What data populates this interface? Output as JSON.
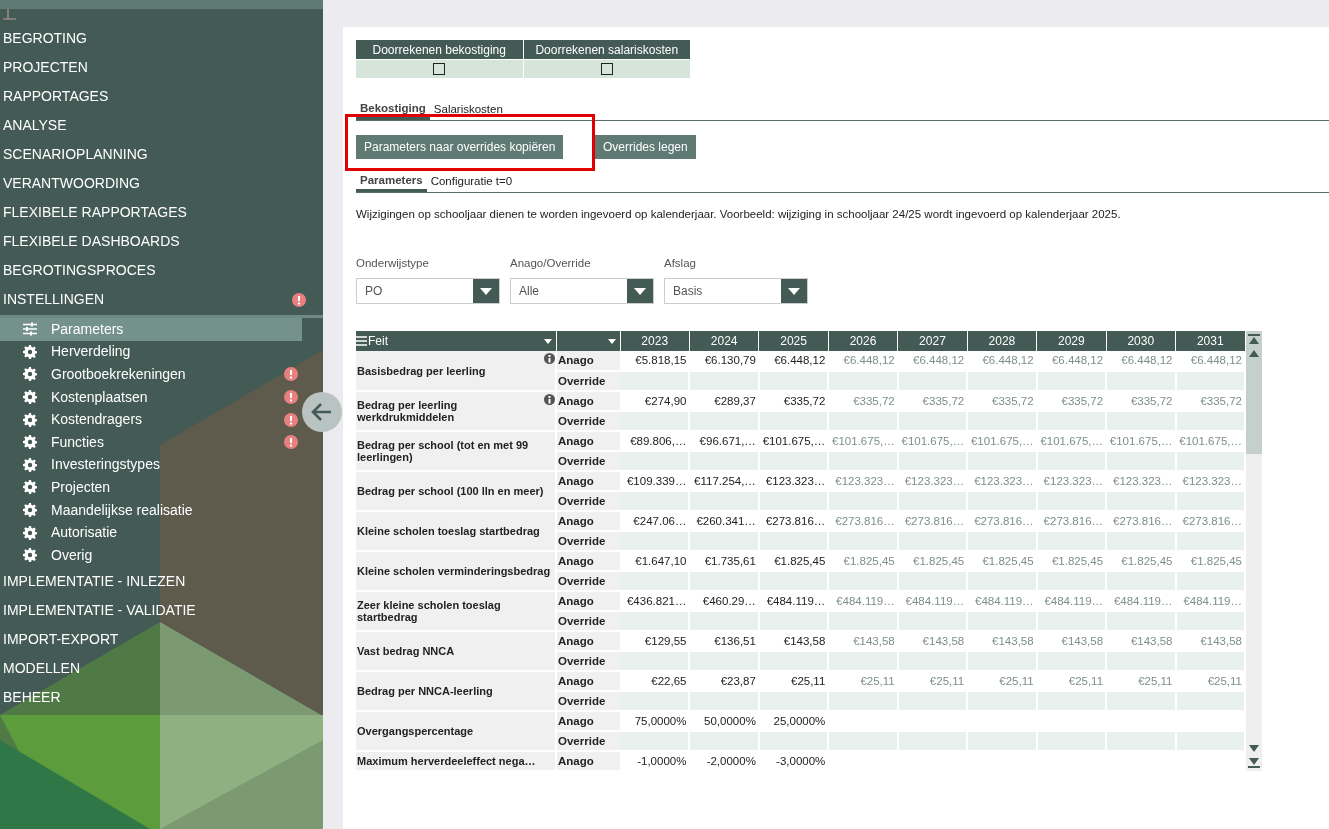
{
  "sidebar": {
    "items": [
      {
        "label": "BEGROTING",
        "alert": false
      },
      {
        "label": "PROJECTEN",
        "alert": false
      },
      {
        "label": "RAPPORTAGES",
        "alert": false
      },
      {
        "label": "ANALYSE",
        "alert": false
      },
      {
        "label": "SCENARIOPLANNING",
        "alert": false
      },
      {
        "label": "VERANTWOORDING",
        "alert": false
      },
      {
        "label": "FLEXIBELE RAPPORTAGES",
        "alert": false
      },
      {
        "label": "FLEXIBELE DASHBOARDS",
        "alert": false
      },
      {
        "label": "BEGROTINGSPROCES",
        "alert": false
      },
      {
        "label": "INSTELLINGEN",
        "alert": true,
        "children": [
          {
            "label": "Parameters",
            "kind": "sliders",
            "selected": true,
            "alert": false
          },
          {
            "label": "Herverdeling",
            "kind": "gear",
            "selected": false,
            "alert": false
          },
          {
            "label": "Grootboekrekeningen",
            "kind": "gear",
            "selected": false,
            "alert": true
          },
          {
            "label": "Kostenplaatsen",
            "kind": "gear",
            "selected": false,
            "alert": true
          },
          {
            "label": "Kostendragers",
            "kind": "gear",
            "selected": false,
            "alert": true
          },
          {
            "label": "Functies",
            "kind": "gear",
            "selected": false,
            "alert": true
          },
          {
            "label": "Investeringstypes",
            "kind": "gear",
            "selected": false,
            "alert": false
          },
          {
            "label": "Projecten",
            "kind": "gear",
            "selected": false,
            "alert": false
          },
          {
            "label": "Maandelijkse realisatie",
            "kind": "gear",
            "selected": false,
            "alert": false
          },
          {
            "label": "Autorisatie",
            "kind": "gear",
            "selected": false,
            "alert": false
          },
          {
            "label": "Overig",
            "kind": "gear",
            "selected": false,
            "alert": false
          }
        ]
      },
      {
        "label": "IMPLEMENTATIE - INLEZEN",
        "alert": false
      },
      {
        "label": "IMPLEMENTATIE - VALIDATIE",
        "alert": false
      },
      {
        "label": "IMPORT-EXPORT",
        "alert": false
      },
      {
        "label": "MODELLEN",
        "alert": false
      },
      {
        "label": "BEHEER",
        "alert": false
      }
    ]
  },
  "recalculate": [
    {
      "label": "Doorrekenen bekostiging",
      "checked": false
    },
    {
      "label": "Doorrekenen salariskosten",
      "checked": false
    }
  ],
  "tabs": [
    {
      "label": "Bekostiging",
      "selected": true
    },
    {
      "label": "Salariskosten",
      "selected": false
    }
  ],
  "buttons": [
    {
      "label": "Parameters naar overrides kopiëren",
      "highlighted": true
    },
    {
      "label": "Overrides legen"
    }
  ],
  "sub_tabs": [
    {
      "label": "Parameters",
      "selected": true
    },
    {
      "label": "Configuratie t=0",
      "selected": false
    }
  ],
  "note": "Wijzigingen op schooljaar dienen te worden ingevoerd op kalenderjaar. Voorbeeld: wijziging in schooljaar 24/25 wordt ingevoerd op kalenderjaar 2025.",
  "filters": [
    {
      "label": "Onderwijstype",
      "value": "PO"
    },
    {
      "label": "Anago/Override",
      "value": "Alle"
    },
    {
      "label": "Afslag",
      "value": "Basis"
    }
  ],
  "table": {
    "fact_column": "Feit",
    "years": [
      {
        "label": "2023",
        "projected": false
      },
      {
        "label": "2024",
        "projected": false
      },
      {
        "label": "2025",
        "projected": false
      },
      {
        "label": "2026",
        "projected": true
      },
      {
        "label": "2027",
        "projected": true
      },
      {
        "label": "2028",
        "projected": true
      },
      {
        "label": "2029",
        "projected": true
      },
      {
        "label": "2030",
        "projected": true
      },
      {
        "label": "2031",
        "projected": true
      }
    ],
    "rows": [
      {
        "label": "Basisbedrag per leerling",
        "info": true,
        "sub_rows": [
          {
            "label": "Anago",
            "values": [
              "€5.818,15",
              "€6.130,79",
              "€6.448,12",
              "€6.448,12",
              "€6.448,12",
              "€6.448,12",
              "€6.448,12",
              "€6.448,12",
              "€6.448,12"
            ]
          },
          {
            "label": "Override",
            "values": []
          }
        ]
      },
      {
        "label": "Bedrag per leerling werkdrukmiddelen",
        "info": true,
        "sub_rows": [
          {
            "label": "Anago",
            "values": [
              "€274,90",
              "€289,37",
              "€335,72",
              "€335,72",
              "€335,72",
              "€335,72",
              "€335,72",
              "€335,72",
              "€335,72"
            ]
          },
          {
            "label": "Override",
            "values": []
          }
        ]
      },
      {
        "label": "Bedrag per school (tot en met 99 leerlingen)",
        "info": false,
        "sub_rows": [
          {
            "label": "Anago",
            "values": [
              "€89.806,…",
              "€96.671,…",
              "€101.675,…",
              "€101.675,…",
              "€101.675,…",
              "€101.675,…",
              "€101.675,…",
              "€101.675,…",
              "€101.675,…"
            ]
          },
          {
            "label": "Override",
            "values": []
          }
        ]
      },
      {
        "label": "Bedrag per school (100 lln en meer)",
        "info": false,
        "sub_rows": [
          {
            "label": "Anago",
            "values": [
              "€109.339…",
              "€117.254,…",
              "€123.323…",
              "€123.323…",
              "€123.323…",
              "€123.323…",
              "€123.323…",
              "€123.323…",
              "€123.323…"
            ]
          },
          {
            "label": "Override",
            "values": []
          }
        ]
      },
      {
        "label": "Kleine scholen toeslag startbedrag",
        "info": false,
        "sub_rows": [
          {
            "label": "Anago",
            "values": [
              "€247.06…",
              "€260.341…",
              "€273.816…",
              "€273.816…",
              "€273.816…",
              "€273.816…",
              "€273.816…",
              "€273.816…",
              "€273.816…"
            ]
          },
          {
            "label": "Override",
            "values": []
          }
        ]
      },
      {
        "label": "Kleine scholen verminderingsbedrag",
        "info": false,
        "sub_rows": [
          {
            "label": "Anago",
            "values": [
              "€1.647,10",
              "€1.735,61",
              "€1.825,45",
              "€1.825,45",
              "€1.825,45",
              "€1.825,45",
              "€1.825,45",
              "€1.825,45",
              "€1.825,45"
            ]
          },
          {
            "label": "Override",
            "values": []
          }
        ]
      },
      {
        "label": "Zeer kleine scholen toeslag startbedrag",
        "info": false,
        "sub_rows": [
          {
            "label": "Anago",
            "values": [
              "€436.821…",
              "€460.29…",
              "€484.119…",
              "€484.119…",
              "€484.119…",
              "€484.119…",
              "€484.119…",
              "€484.119…",
              "€484.119…"
            ]
          },
          {
            "label": "Override",
            "values": []
          }
        ]
      },
      {
        "label": "Vast bedrag NNCA",
        "info": false,
        "sub_rows": [
          {
            "label": "Anago",
            "values": [
              "€129,55",
              "€136,51",
              "€143,58",
              "€143,58",
              "€143,58",
              "€143,58",
              "€143,58",
              "€143,58",
              "€143,58"
            ]
          },
          {
            "label": "Override",
            "values": []
          }
        ]
      },
      {
        "label": "Bedrag per NNCA-leerling",
        "info": false,
        "sub_rows": [
          {
            "label": "Anago",
            "values": [
              "€22,65",
              "€23,87",
              "€25,11",
              "€25,11",
              "€25,11",
              "€25,11",
              "€25,11",
              "€25,11",
              "€25,11"
            ]
          },
          {
            "label": "Override",
            "values": []
          }
        ]
      },
      {
        "label": "Overgangspercentage",
        "info": false,
        "sub_rows": [
          {
            "label": "Anago",
            "values": [
              "75,0000%",
              "50,0000%",
              "25,0000%"
            ]
          },
          {
            "label": "Override",
            "values": []
          }
        ]
      },
      {
        "label": "Maximum herverdeeleffect nega…",
        "info": false,
        "sub_rows": [
          {
            "label": "Anago",
            "values": [
              "-1,0000%",
              "-2,0000%",
              "-3,0000%"
            ]
          }
        ]
      }
    ]
  }
}
